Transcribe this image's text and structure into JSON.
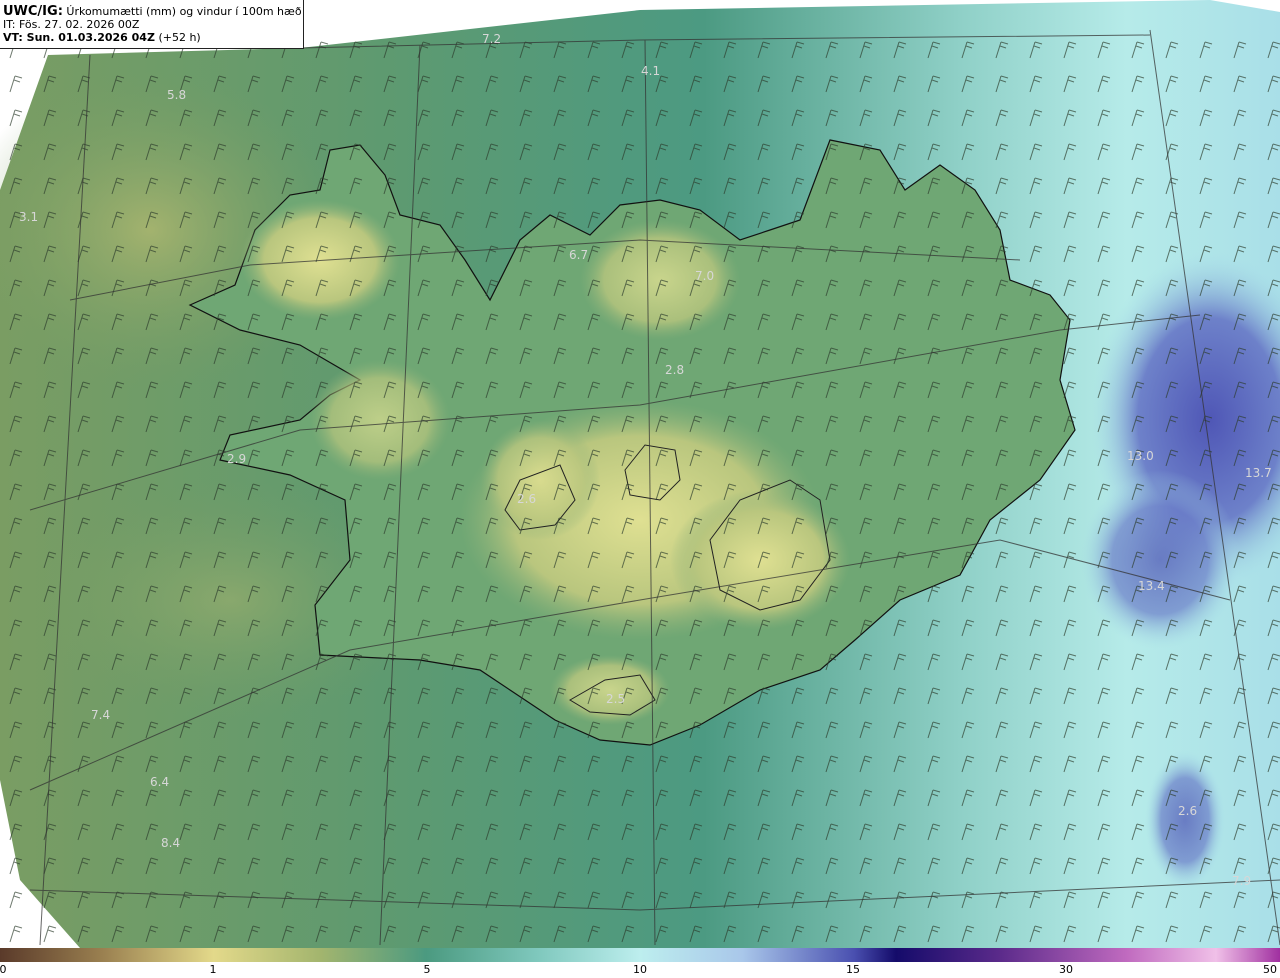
{
  "title": {
    "model": "UWC/IG:",
    "description": "Úrkomumætti (mm) og vindur í 100m hæð",
    "it_line": "IT: Fös. 27. 02. 2026 00Z",
    "vt_label": "VT: Sun. 01.03.2026 04Z",
    "vt_offset": "(+52 h)"
  },
  "colors": {
    "land_low": "#d8dc8a",
    "sea_mid": "#4b9a80",
    "sea_high": "#aee6e6",
    "precip_high": "#4f55b8",
    "background": "#ffffff"
  },
  "map_labels": [
    {
      "id": "l1",
      "text": "7.2"
    },
    {
      "id": "l2",
      "text": "4.1"
    },
    {
      "id": "l3",
      "text": "5.8"
    },
    {
      "id": "l4",
      "text": "3.1"
    },
    {
      "id": "l5",
      "text": "6.7"
    },
    {
      "id": "l6",
      "text": "7.0"
    },
    {
      "id": "l7",
      "text": "2.8"
    },
    {
      "id": "l8",
      "text": "2.9"
    },
    {
      "id": "l9",
      "text": "2.6"
    },
    {
      "id": "l10",
      "text": "13.0"
    },
    {
      "id": "l11",
      "text": "13.7"
    },
    {
      "id": "l12",
      "text": "13.4"
    },
    {
      "id": "l13",
      "text": "2.5"
    },
    {
      "id": "l14",
      "text": "7.4"
    },
    {
      "id": "l15",
      "text": "6.4"
    },
    {
      "id": "l16",
      "text": "8.4"
    },
    {
      "id": "l17",
      "text": "2.6"
    },
    {
      "id": "l18",
      "text": "7.9"
    }
  ],
  "colorbar": {
    "ticks": [
      {
        "value": 0,
        "label": "0"
      },
      {
        "value": 1,
        "label": "1"
      },
      {
        "value": 5,
        "label": "5"
      },
      {
        "value": 10,
        "label": "10"
      },
      {
        "value": 15,
        "label": "15"
      },
      {
        "value": 30,
        "label": "30"
      },
      {
        "value": 50,
        "label": "50"
      }
    ]
  }
}
